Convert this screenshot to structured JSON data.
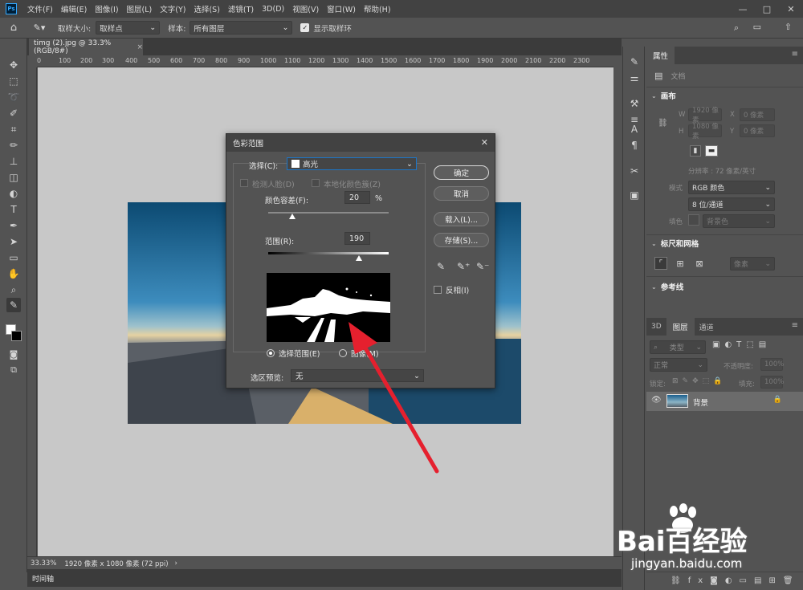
{
  "menu": [
    "文件(F)",
    "编辑(E)",
    "图像(I)",
    "图层(L)",
    "文字(Y)",
    "选择(S)",
    "滤镜(T)",
    "3D(D)",
    "视图(V)",
    "窗口(W)",
    "帮助(H)"
  ],
  "window_buttons": [
    "—",
    "□",
    "✕"
  ],
  "options_bar": {
    "sample_size_label": "取样大小:",
    "sample_size_value": "取样点",
    "sample_label": "样本:",
    "sample_value": "所有图层",
    "show_ring_label": "显示取样环"
  },
  "document_tab": {
    "title": "timg (2).jpg @ 33.3%(RGB/8#)",
    "close": "×"
  },
  "ruler_top": [
    "0",
    "100",
    "200",
    "300",
    "400",
    "500",
    "600",
    "700",
    "800",
    "900",
    "1000",
    "1100",
    "1200",
    "1300",
    "1400",
    "1500",
    "1600",
    "1700",
    "1800",
    "1900",
    "2000",
    "2100",
    "2200",
    "2300"
  ],
  "status": {
    "zoom": "33.33%",
    "info": "1920 像素 x 1080 像素 (72 ppi)",
    "arrow": "›"
  },
  "timeline_tab": "时间轴",
  "dialog": {
    "title": "色彩范围",
    "close": "✕",
    "select_label": "选择(C):",
    "select_value": "高光",
    "detect_faces": "检测人脸(D)",
    "localized": "本地化颜色簇(Z)",
    "fuzziness_label": "颜色容差(F):",
    "fuzziness_value": "20",
    "percent": "%",
    "range_label": "范围(R):",
    "range_value": "190",
    "fuzziness_slider": 0.2,
    "range_slider": 0.75,
    "ok": "确定",
    "cancel": "取消",
    "load": "载入(L)...",
    "save": "存储(S)...",
    "invert": "反相(I)",
    "radio_selection": "选择范围(E)",
    "radio_image": "图像(M)",
    "preview_label": "选区预览:",
    "preview_value": "无"
  },
  "properties": {
    "tab": "属性",
    "doc_label": "文档",
    "canvas_section": "画布",
    "w_label": "W",
    "w_value": "1920 像素",
    "x_label": "X",
    "x_value": "0 像素",
    "h_label": "H",
    "h_value": "1080 像素",
    "y_label": "Y",
    "y_value": "0 像素",
    "resolution": "分辨率 : 72 像素/英寸",
    "mode_label": "模式",
    "mode_value": "RGB 颜色",
    "depth_value": "8 位/通道",
    "fill_label": "填色",
    "fill_value": "背景色",
    "rulers_section": "标尺和网格",
    "units_value": "像素",
    "guides_section": "参考线"
  },
  "layers": {
    "tabs": [
      "3D",
      "图层",
      "通道"
    ],
    "filter_placeholder": "类型",
    "blend_mode": "正常",
    "opacity_label": "不透明度:",
    "opacity_value": "100%",
    "lock_label": "锁定:",
    "fill_label": "填充:",
    "fill_value": "100%",
    "layer_name": "背景"
  },
  "watermark": {
    "brand": "Bai百经验",
    "url": "jingyan.baidu.com"
  },
  "colors": {
    "accent_arrow": "#e5202e",
    "panel_bg": "#535353",
    "canvas_bg": "#c8c8c8"
  }
}
